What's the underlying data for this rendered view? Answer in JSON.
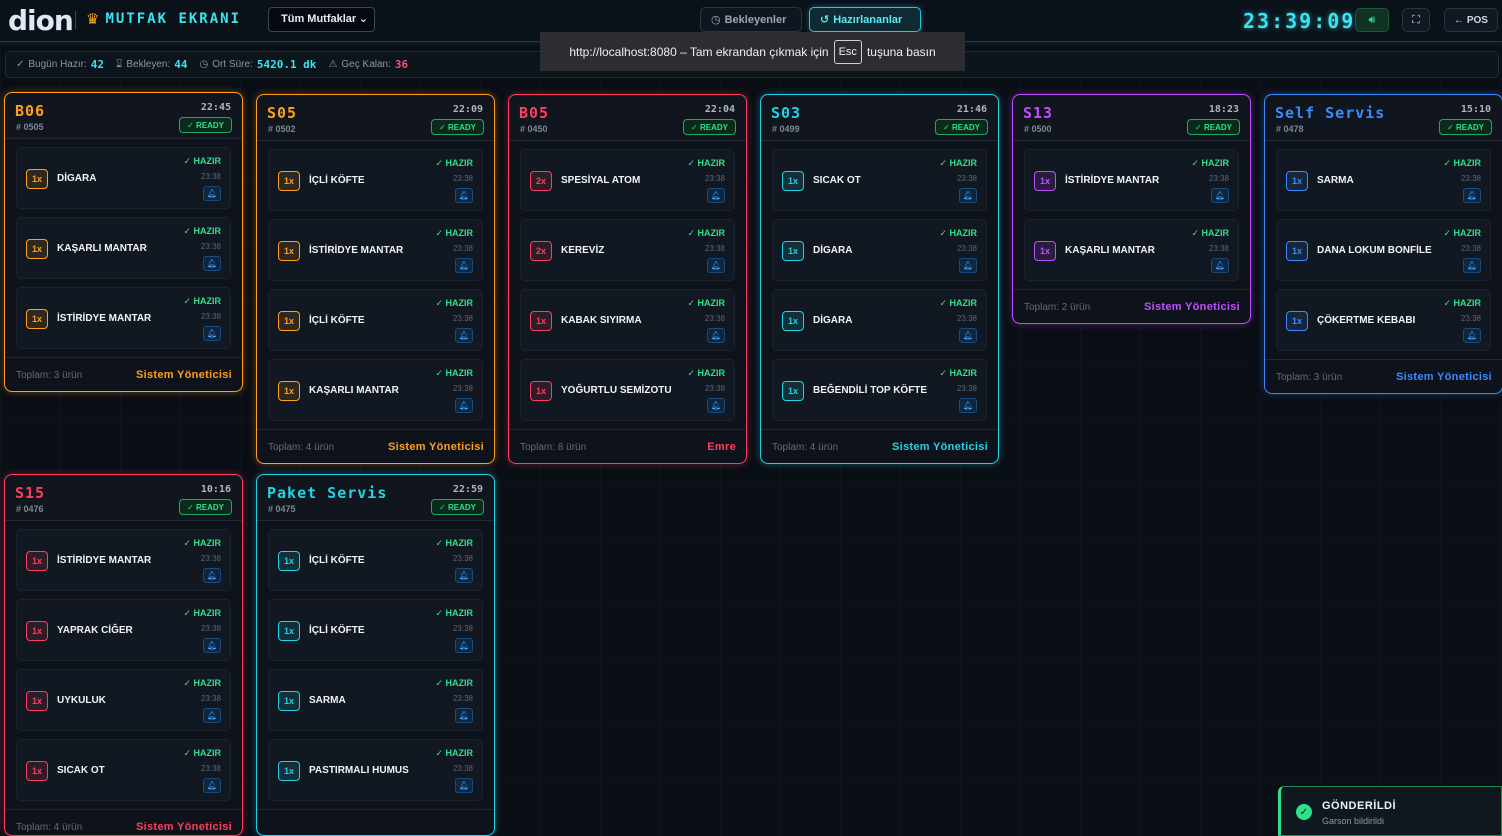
{
  "header": {
    "logo": "dion",
    "brand_icon": "chef-icon",
    "brand": "MUTFAK EKRANI",
    "kitchen_select": "Tüm Mutfaklar",
    "tabs": [
      {
        "label": "Bekleyenler",
        "icon": "clock-icon"
      },
      {
        "label": "Hazırlananlar",
        "icon": "history-icon",
        "active": true
      }
    ],
    "clock": "23:39:09",
    "pos_label": "POS"
  },
  "fullscreen_toast": {
    "before": "http://localhost:8080 – Tam ekrandan çıkmak için",
    "key": "Esc",
    "after": "tuşuna basın"
  },
  "stats": [
    {
      "label": "Bugün Hazır:",
      "value": "42",
      "icon": "check-icon",
      "color": "#3be3f0"
    },
    {
      "label": "Bekleyen:",
      "value": "44",
      "icon": "hourglass-icon",
      "color": "#3be3f0"
    },
    {
      "label": "Ort Süre:",
      "value": "5420.1 dk",
      "icon": "clock-icon",
      "color": "#3be3f0"
    },
    {
      "label": "Geç Kalan:",
      "value": "36",
      "icon": "warning-icon",
      "color": "#ff4d6d"
    }
  ],
  "common": {
    "ready_badge": "✓ READY",
    "item_status": "✓ HAZIR",
    "item_time": "23:38"
  },
  "orders": [
    {
      "table": "B06",
      "no": "# 0505",
      "time": "22:45",
      "color": "#ff9f1c",
      "total": "Toplam: 3 ürün",
      "waiter": "Sistem Yöneticisi",
      "items": [
        {
          "qty": "1x",
          "name": "DİGARA"
        },
        {
          "qty": "1x",
          "name": "KAŞARLI MANTAR"
        },
        {
          "qty": "1x",
          "name": "İSTİRİDYE MANTAR"
        }
      ]
    },
    {
      "table": "S05",
      "no": "# 0502",
      "time": "22:09",
      "color": "#ff9f1c",
      "total": "Toplam: 4 ürün",
      "waiter": "Sistem Yöneticisi",
      "items": [
        {
          "qty": "1x",
          "name": "İÇLİ KÖFTE"
        },
        {
          "qty": "1x",
          "name": "İSTİRİDYE MANTAR"
        },
        {
          "qty": "1x",
          "name": "İÇLİ KÖFTE"
        },
        {
          "qty": "1x",
          "name": "KAŞARLI MANTAR"
        }
      ]
    },
    {
      "table": "B05",
      "no": "# 0450",
      "time": "22:04",
      "color": "#ff3d5e",
      "total": "Toplam: 8 ürün",
      "waiter": "Emre",
      "items": [
        {
          "qty": "2x",
          "name": "SPESİYAL ATOM"
        },
        {
          "qty": "2x",
          "name": "KEREVİZ"
        },
        {
          "qty": "1x",
          "name": "KABAK SIYIRMA"
        },
        {
          "qty": "1x",
          "name": "YOĞURTLU SEMİZOTU"
        }
      ]
    },
    {
      "table": "S03",
      "no": "# 0499",
      "time": "21:46",
      "color": "#22d3e6",
      "total": "Toplam: 4 ürün",
      "waiter": "Sistem Yöneticisi",
      "items": [
        {
          "qty": "1x",
          "name": "SICAK OT"
        },
        {
          "qty": "1x",
          "name": "DİGARA"
        },
        {
          "qty": "1x",
          "name": "DİGARA"
        },
        {
          "qty": "1x",
          "name": "BEĞENDİLİ TOP KÖFTE"
        }
      ]
    },
    {
      "table": "S13",
      "no": "# 0500",
      "time": "18:23",
      "color": "#c04dff",
      "total": "Toplam: 2 ürün",
      "waiter": "Sistem Yöneticisi",
      "items": [
        {
          "qty": "1x",
          "name": "İSTİRİDYE MANTAR"
        },
        {
          "qty": "1x",
          "name": "KAŞARLI MANTAR"
        }
      ]
    },
    {
      "table": "Self Servis",
      "no": "# 0478",
      "time": "15:10",
      "color": "#3b8bff",
      "total": "Toplam: 3 ürün",
      "waiter": "Sistem Yöneticisi",
      "items": [
        {
          "qty": "1x",
          "name": "SARMA"
        },
        {
          "qty": "1x",
          "name": "DANA LOKUM BONFİLE"
        },
        {
          "qty": "1x",
          "name": "ÇÖKERTME KEBABI"
        }
      ]
    },
    {
      "table": "S15",
      "no": "# 0476",
      "time": "10:16",
      "color": "#ff3d5e",
      "total": "Toplam: 4 ürün",
      "waiter": "Sistem Yöneticisi",
      "items": [
        {
          "qty": "1x",
          "name": "İSTİRİDYE MANTAR"
        },
        {
          "qty": "1x",
          "name": "YAPRAK CİĞER"
        },
        {
          "qty": "1x",
          "name": "UYKULUK"
        },
        {
          "qty": "1x",
          "name": "SICAK OT"
        }
      ]
    },
    {
      "table": "Paket Servis",
      "no": "# 0475",
      "time": "22:59",
      "color": "#22d3e6",
      "total": "",
      "waiter": "",
      "items": [
        {
          "qty": "1x",
          "name": "İÇLİ KÖFTE"
        },
        {
          "qty": "1x",
          "name": "İÇLİ KÖFTE"
        },
        {
          "qty": "1x",
          "name": "SARMA"
        },
        {
          "qty": "1x",
          "name": "PASTIRMALI HUMUS"
        }
      ]
    }
  ],
  "notification": {
    "title": "GÖNDERİLDİ",
    "text": "Garson bildirildi",
    "color": "#2fe08a"
  }
}
